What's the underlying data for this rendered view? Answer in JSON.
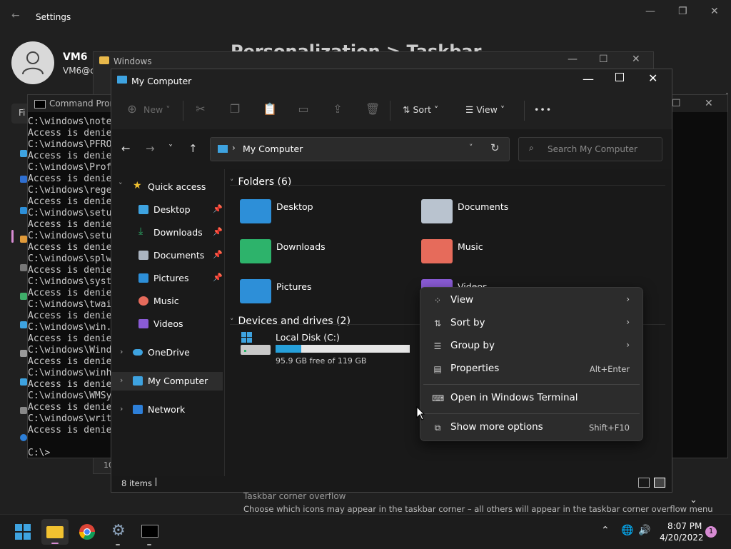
{
  "settings": {
    "title": "Settings",
    "user_name": "VM6",
    "user_email": "VM6@c",
    "heading": "Personalization > Taskbar",
    "overflow_title": "Taskbar corner overflow",
    "overflow_desc": "Choose which icons may appear in the taskbar corner – all others will appear in the taskbar corner overflow menu",
    "tab_partial": "Fi"
  },
  "folder_window": {
    "title": "Windows",
    "status": "10"
  },
  "cmd": {
    "title": "Command Prom",
    "lines": [
      "C:\\windows\\note",
      "Access is denie",
      "C:\\windows\\PFRO",
      "Access is denie",
      "C:\\windows\\Prof",
      "Access is denie",
      "C:\\windows\\rege",
      "Access is denie",
      "C:\\windows\\setu",
      "Access is denie",
      "C:\\windows\\setu",
      "Access is denie",
      "C:\\windows\\splw",
      "Access is denie",
      "C:\\windows\\syst",
      "Access is denie",
      "C:\\windows\\twai",
      "Access is denie",
      "C:\\windows\\win.",
      "Access is denie",
      "C:\\windows\\Wind",
      "Access is denie",
      "C:\\windows\\winh",
      "Access is denie",
      "C:\\windows\\WMSy",
      "Access is denie",
      "C:\\windows\\writ",
      "Access is denie"
    ],
    "prompt": "C:\\>"
  },
  "explorer": {
    "title": "My Computer",
    "toolbar": {
      "new_label": "New",
      "sort_label": "Sort",
      "view_label": "View",
      "more_label": "•••"
    },
    "address": {
      "path": "My Computer",
      "search_placeholder": "Search My Computer"
    },
    "nav": {
      "quick_access": "Quick access",
      "items": [
        {
          "label": "Desktop"
        },
        {
          "label": "Downloads"
        },
        {
          "label": "Documents"
        },
        {
          "label": "Pictures"
        },
        {
          "label": "Music"
        },
        {
          "label": "Videos"
        }
      ],
      "onedrive": "OneDrive",
      "my_computer": "My Computer",
      "network": "Network"
    },
    "folders_header": "Folders (6)",
    "folders": [
      {
        "name": "Desktop"
      },
      {
        "name": "Documents"
      },
      {
        "name": "Downloads"
      },
      {
        "name": "Music"
      },
      {
        "name": "Pictures"
      },
      {
        "name": "Videos"
      }
    ],
    "drives_header": "Devices and drives (2)",
    "drive": {
      "name": "Local Disk (C:)",
      "free": "95.9 GB free of 119 GB",
      "used_fraction": 0.194
    },
    "status": "8 items"
  },
  "context_menu": {
    "items": [
      {
        "label": "View",
        "icon": "grid-icon",
        "shortcut": ""
      },
      {
        "label": "Sort by",
        "icon": "sort-icon",
        "shortcut": ""
      },
      {
        "label": "Group by",
        "icon": "list-icon",
        "shortcut": ""
      },
      {
        "label": "Properties",
        "icon": "properties-icon",
        "shortcut": "Alt+Enter"
      },
      {
        "label": "Open in Windows Terminal",
        "icon": "terminal-icon",
        "shortcut": ""
      },
      {
        "label": "Show more options",
        "icon": "more-options-icon",
        "shortcut": "Shift+F10"
      }
    ]
  },
  "taskbar": {
    "time": "8:07 PM",
    "date": "4/20/2022",
    "notification_count": "1"
  },
  "colors": {
    "accent": "#26a0da",
    "folder_blue": "#3ea3e0",
    "music": "#e66b5b",
    "downloads": "#2db36b"
  }
}
